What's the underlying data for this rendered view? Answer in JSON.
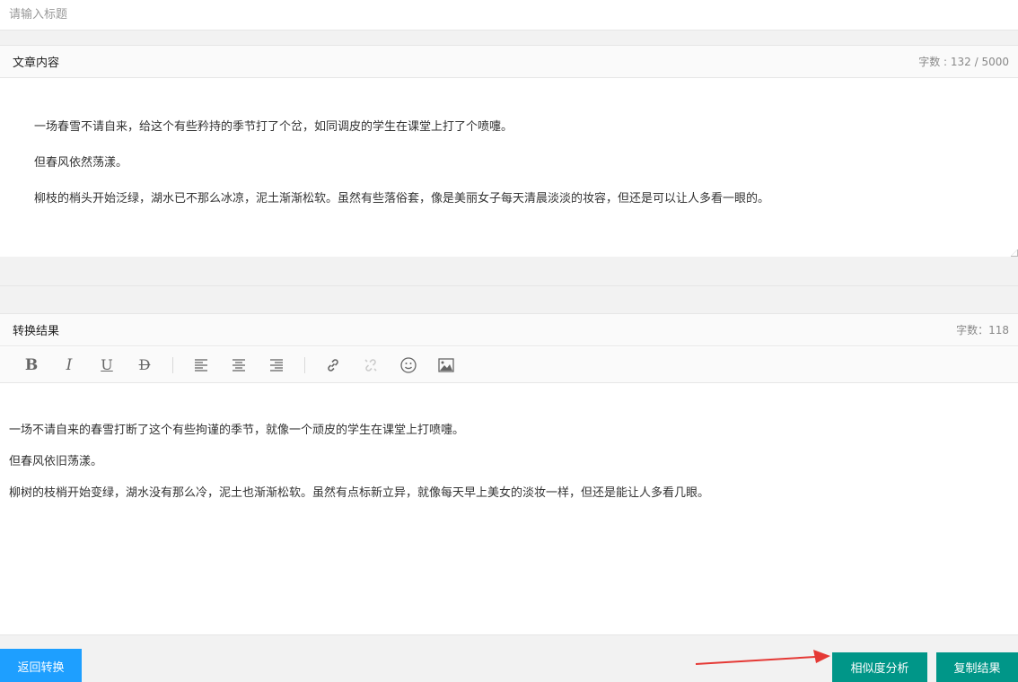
{
  "title_input": {
    "placeholder": "请输入标题",
    "value": ""
  },
  "source": {
    "label": "文章内容",
    "count": "字数 : 132 / 5000",
    "paragraphs": [
      "一场春雪不请自来，给这个有些矜持的季节打了个岔，如同调皮的学生在课堂上打了个喷嚏。",
      "但春风依然荡漾。",
      "柳枝的梢头开始泛绿，湖水已不那么冰凉，泥土渐渐松软。虽然有些落俗套，像是美丽女子每天清晨淡淡的妆容，但还是可以让人多看一眼的。"
    ]
  },
  "result": {
    "label": "转换结果",
    "count": "字数：118",
    "paragraphs": [
      "一场不请自来的春雪打断了这个有些拘谨的季节，就像一个顽皮的学生在课堂上打喷嚏。",
      "但春风依旧荡漾。",
      "柳树的枝梢开始变绿，湖水没有那么冷，泥土也渐渐松软。虽然有点标新立异，就像每天早上美女的淡妆一样，但还是能让人多看几眼。"
    ]
  },
  "toolbar": {
    "items": [
      "bold-icon",
      "italic-icon",
      "underline-icon",
      "strikethrough-icon",
      "align-left-icon",
      "align-center-icon",
      "align-right-icon",
      "link-icon",
      "unlink-icon",
      "emoji-icon",
      "image-icon"
    ],
    "bold_glyph": "B",
    "italic_glyph": "I",
    "underline_glyph": "U",
    "strike_glyph": "D"
  },
  "buttons": {
    "back": "返回转换",
    "similarity": "相似度分析",
    "copy": "复制结果"
  },
  "colors": {
    "primary_blue": "#1e9fff",
    "primary_green": "#009688",
    "annotation_arrow": "#e53935"
  }
}
